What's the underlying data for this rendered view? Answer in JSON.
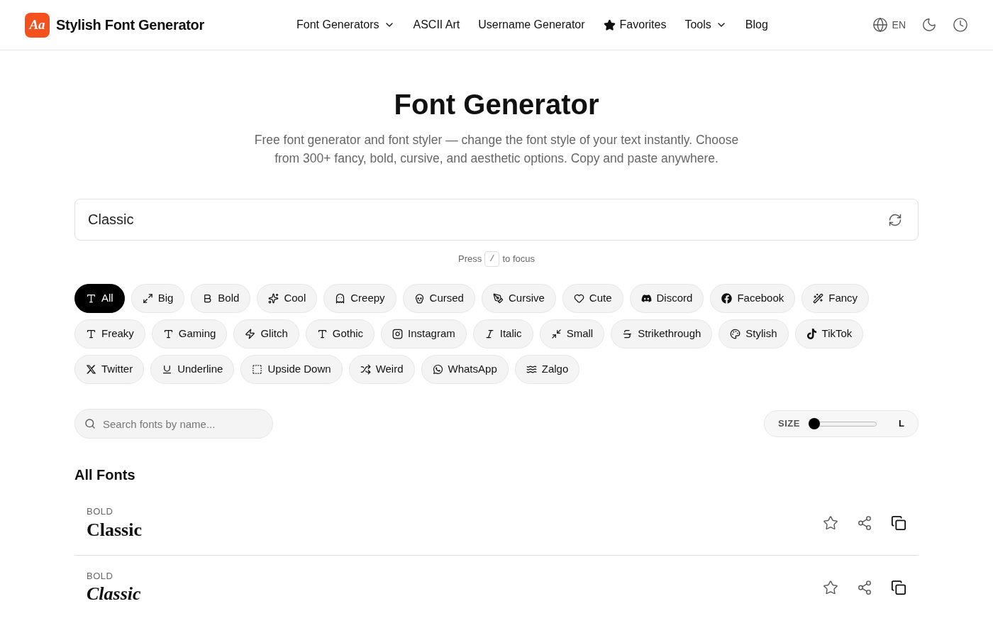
{
  "header": {
    "logo": "Aa",
    "brand": "Stylish Font Generator",
    "nav": [
      {
        "label": "Font Generators",
        "kind": "dropdown"
      },
      {
        "label": "ASCII Art",
        "kind": "link"
      },
      {
        "label": "Username Generator",
        "kind": "link"
      },
      {
        "label": "Favorites",
        "kind": "starred"
      },
      {
        "label": "Tools",
        "kind": "dropdown"
      },
      {
        "label": "Blog",
        "kind": "link"
      }
    ],
    "language": "EN"
  },
  "hero": {
    "title": "Font Generator",
    "description": "Free font generator and font styler — change the font style of your text instantly. Choose from 300+ fancy, bold, cursive, and aesthetic options. Copy and paste anywhere."
  },
  "text_input": {
    "value": "Classic"
  },
  "hint": {
    "before": "Press",
    "key": "/",
    "after": "to focus"
  },
  "categories": [
    {
      "label": "All",
      "selected": true
    },
    {
      "label": "Big",
      "selected": false
    },
    {
      "label": "Bold",
      "selected": false
    },
    {
      "label": "Cool",
      "selected": false
    },
    {
      "label": "Creepy",
      "selected": false
    },
    {
      "label": "Cursed",
      "selected": false
    },
    {
      "label": "Cursive",
      "selected": false
    },
    {
      "label": "Cute",
      "selected": false
    },
    {
      "label": "Discord",
      "selected": false
    },
    {
      "label": "Facebook",
      "selected": false
    },
    {
      "label": "Fancy",
      "selected": false
    },
    {
      "label": "Freaky",
      "selected": false
    },
    {
      "label": "Gaming",
      "selected": false
    },
    {
      "label": "Glitch",
      "selected": false
    },
    {
      "label": "Gothic",
      "selected": false
    },
    {
      "label": "Instagram",
      "selected": false
    },
    {
      "label": "Italic",
      "selected": false
    },
    {
      "label": "Small",
      "selected": false
    },
    {
      "label": "Strikethrough",
      "selected": false
    },
    {
      "label": "Stylish",
      "selected": false
    },
    {
      "label": "TikTok",
      "selected": false
    },
    {
      "label": "Twitter",
      "selected": false
    },
    {
      "label": "Underline",
      "selected": false
    },
    {
      "label": "Upside Down",
      "selected": false
    },
    {
      "label": "Weird",
      "selected": false
    },
    {
      "label": "WhatsApp",
      "selected": false
    },
    {
      "label": "Zalgo",
      "selected": false
    }
  ],
  "search": {
    "placeholder": "Search fonts by name..."
  },
  "size": {
    "label": "SIZE",
    "level": 0.0,
    "end_label": "L"
  },
  "section_title": "All Fonts",
  "fonts": [
    {
      "tag": "BOLD",
      "sample": "Classic",
      "kind": "bold"
    },
    {
      "tag": "BOLD",
      "sample": "Classic",
      "kind": "bold_italic"
    }
  ]
}
